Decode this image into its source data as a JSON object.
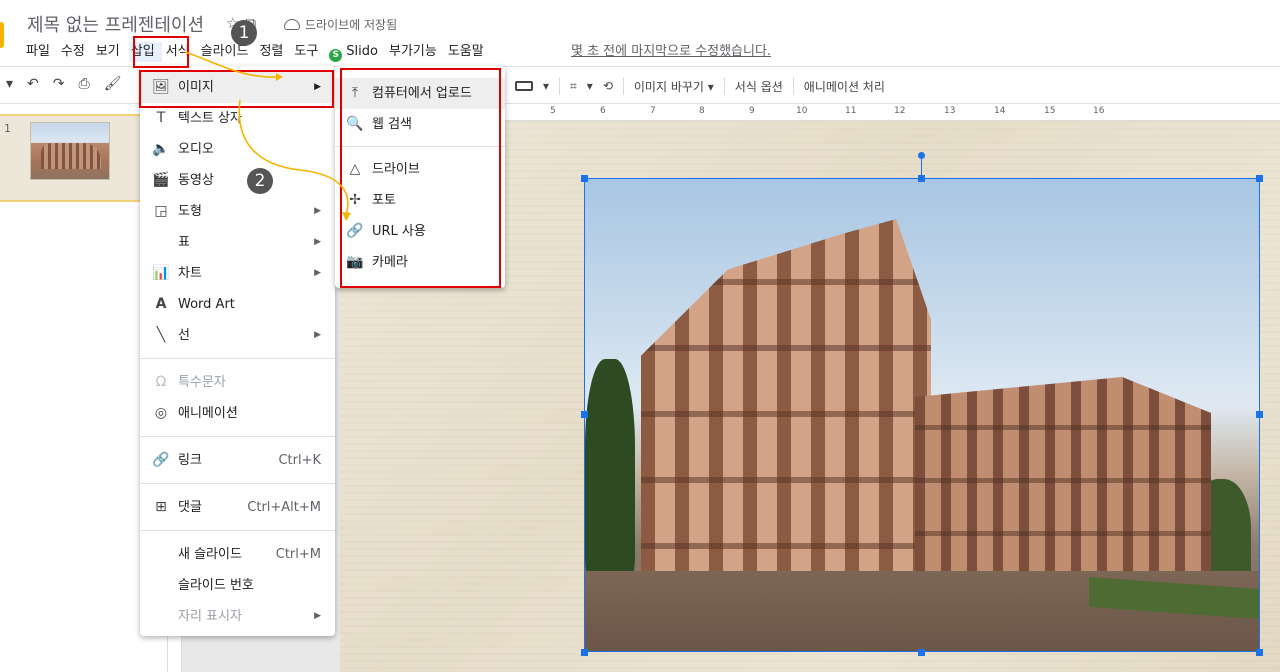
{
  "app": {
    "doc_title": "제목 없는 프레젠테이션",
    "save_status": "드라이브에 저장됨"
  },
  "menubar": {
    "items": [
      "파일",
      "수정",
      "보기",
      "삽입",
      "서식",
      "슬라이드",
      "정렬",
      "도구",
      "Slido",
      "부가기능",
      "도움말"
    ],
    "last_edit": "몇 초 전에 마지막으로 수정했습니다."
  },
  "toolbar": {
    "replace_image": "이미지 바꾸기",
    "format_options": "서식 옵션",
    "animate": "애니메이션 처리"
  },
  "ruler": {
    "ticks": [
      "5",
      "6",
      "7",
      "8",
      "9",
      "10",
      "11",
      "12",
      "13",
      "14",
      "15",
      "16"
    ]
  },
  "filmstrip": {
    "slide_number": "1"
  },
  "insert_menu": {
    "image": "이미지",
    "text_box": "텍스트 상자",
    "audio": "오디오",
    "video": "동영상",
    "shape": "도형",
    "table": "표",
    "chart": "차트",
    "word_art": "Word Art",
    "line": "선",
    "special_chars": "특수문자",
    "animation": "애니메이션",
    "link": "링크",
    "link_shortcut": "Ctrl+K",
    "comment": "댓글",
    "comment_shortcut": "Ctrl+Alt+M",
    "new_slide": "새 슬라이드",
    "new_slide_shortcut": "Ctrl+M",
    "slide_numbers": "슬라이드 번호",
    "placeholder": "자리 표시자"
  },
  "image_submenu": {
    "upload": "컴퓨터에서 업로드",
    "web_search": "웹 검색",
    "drive": "드라이브",
    "photos": "포토",
    "by_url": "URL 사용",
    "camera": "카메라"
  },
  "annotations": {
    "step1": "1",
    "step2": "2",
    "highlight_color": "#e00000",
    "arrow_color": "#f4b400"
  }
}
